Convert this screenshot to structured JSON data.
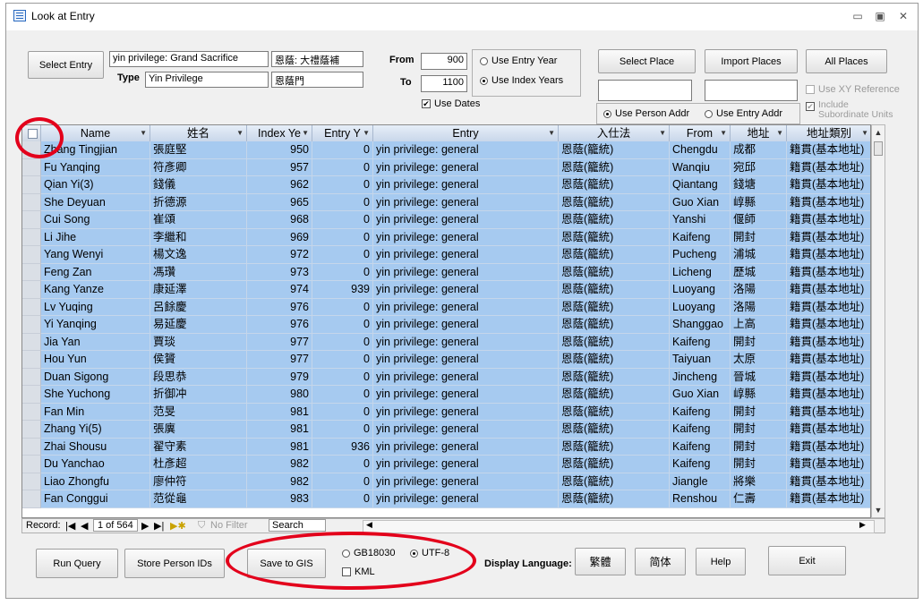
{
  "window": {
    "title": "Look at Entry",
    "controls": [
      "▭",
      "▣",
      "✕"
    ]
  },
  "top": {
    "select_entry_label": "Select Entry",
    "entry_value": "yin privilege: Grand Sacrifice",
    "entry_value_chn": "恩蔭: 大禮蔭補",
    "type_label": "Type",
    "type_value": "Yin Privilege",
    "type_value_chn": "恩蔭門",
    "from_label": "From",
    "from_value": "900",
    "to_label": "To",
    "to_value": "1100",
    "use_entry_year": "Use Entry Year",
    "use_index_years": "Use Index Years",
    "use_dates": "Use Dates",
    "select_place": "Select Place",
    "import_places": "Import Places",
    "all_places": "All Places",
    "use_xy_reference": "Use XY Reference",
    "include_subordinate": "Include Subordinate Units",
    "use_person_addr": "Use Person Addr",
    "use_entry_addr": "Use Entry Addr"
  },
  "grid": {
    "headers": [
      "Name",
      "姓名",
      "Index Ye",
      "Entry Y",
      "Entry",
      "入仕法",
      "From",
      "地址",
      "地址類別"
    ],
    "rows": [
      [
        "Zhang Tingjian",
        "張庭堅",
        "950",
        "0",
        "yin privilege: general",
        "恩蔭(籠統)",
        "Chengdu",
        "成都",
        "籍貫(基本地址)"
      ],
      [
        "Fu Yanqing",
        "符彥卿",
        "957",
        "0",
        "yin privilege: general",
        "恩蔭(籠統)",
        "Wanqiu",
        "宛邱",
        "籍貫(基本地址)"
      ],
      [
        "Qian Yi(3)",
        "錢儀",
        "962",
        "0",
        "yin privilege: general",
        "恩蔭(籠統)",
        "Qiantang",
        "錢塘",
        "籍貫(基本地址)"
      ],
      [
        "She Deyuan",
        "折德源",
        "965",
        "0",
        "yin privilege: general",
        "恩蔭(籠統)",
        "Guo Xian",
        "崞縣",
        "籍貫(基本地址)"
      ],
      [
        "Cui Song",
        "崔頌",
        "968",
        "0",
        "yin privilege: general",
        "恩蔭(籠統)",
        "Yanshi",
        "偃師",
        "籍貫(基本地址)"
      ],
      [
        "Li Jihe",
        "李繼和",
        "969",
        "0",
        "yin privilege: general",
        "恩蔭(籠統)",
        "Kaifeng",
        "開封",
        "籍貫(基本地址)"
      ],
      [
        "Yang Wenyi",
        "楊文逸",
        "972",
        "0",
        "yin privilege: general",
        "恩蔭(籠統)",
        "Pucheng",
        "浦城",
        "籍貫(基本地址)"
      ],
      [
        "Feng Zan",
        "馮瓚",
        "973",
        "0",
        "yin privilege: general",
        "恩蔭(籠統)",
        "Licheng",
        "歷城",
        "籍貫(基本地址)"
      ],
      [
        "Kang Yanze",
        "康延澤",
        "974",
        "939",
        "yin privilege: general",
        "恩蔭(籠統)",
        "Luoyang",
        "洛陽",
        "籍貫(基本地址)"
      ],
      [
        "Lv Yuqing",
        "呂餘慶",
        "976",
        "0",
        "yin privilege: general",
        "恩蔭(籠統)",
        "Luoyang",
        "洛陽",
        "籍貫(基本地址)"
      ],
      [
        "Yi Yanqing",
        "易延慶",
        "976",
        "0",
        "yin privilege: general",
        "恩蔭(籠統)",
        "Shanggao",
        "上高",
        "籍貫(基本地址)"
      ],
      [
        "Jia Yan",
        "賈琰",
        "977",
        "0",
        "yin privilege: general",
        "恩蔭(籠統)",
        "Kaifeng",
        "開封",
        "籍貫(基本地址)"
      ],
      [
        "Hou Yun",
        "侯贇",
        "977",
        "0",
        "yin privilege: general",
        "恩蔭(籠統)",
        "Taiyuan",
        "太原",
        "籍貫(基本地址)"
      ],
      [
        "Duan Sigong",
        "段思恭",
        "979",
        "0",
        "yin privilege: general",
        "恩蔭(籠統)",
        "Jincheng",
        "晉城",
        "籍貫(基本地址)"
      ],
      [
        "She Yuchong",
        "折御冲",
        "980",
        "0",
        "yin privilege: general",
        "恩蔭(籠統)",
        "Guo Xian",
        "崞縣",
        "籍貫(基本地址)"
      ],
      [
        "Fan Min",
        "范旻",
        "981",
        "0",
        "yin privilege: general",
        "恩蔭(籠統)",
        "Kaifeng",
        "開封",
        "籍貫(基本地址)"
      ],
      [
        "Zhang Yi(5)",
        "張廙",
        "981",
        "0",
        "yin privilege: general",
        "恩蔭(籠統)",
        "Kaifeng",
        "開封",
        "籍貫(基本地址)"
      ],
      [
        "Zhai Shousu",
        "翟守素",
        "981",
        "936",
        "yin privilege: general",
        "恩蔭(籠統)",
        "Kaifeng",
        "開封",
        "籍貫(基本地址)"
      ],
      [
        "Du Yanchao",
        "杜彥超",
        "982",
        "0",
        "yin privilege: general",
        "恩蔭(籠統)",
        "Kaifeng",
        "開封",
        "籍貫(基本地址)"
      ],
      [
        "Liao Zhongfu",
        "廖仲符",
        "982",
        "0",
        "yin privilege: general",
        "恩蔭(籠統)",
        "Jiangle",
        "將樂",
        "籍貫(基本地址)"
      ],
      [
        "Fan Conggui",
        "范從龜",
        "983",
        "0",
        "yin privilege: general",
        "恩蔭(籠統)",
        "Renshou",
        "仁壽",
        "籍貫(基本地址)"
      ]
    ]
  },
  "navbar": {
    "record_label": "Record:",
    "first": "|◀",
    "prev": "◀",
    "position": "1 of 564",
    "next": "▶",
    "last": "▶|",
    "new": "▶✱",
    "filter": "No Filter",
    "search": "Search"
  },
  "bottom": {
    "run_query": "Run Query",
    "store_person_ids": "Store Person IDs",
    "save_to_gis": "Save to GIS",
    "gb18030": "GB18030",
    "utf8": "UTF-8",
    "kml": "KML",
    "display_language": "Display Language:",
    "trad": "繁體",
    "simp": "简体",
    "help": "Help",
    "exit": "Exit"
  },
  "colors": {
    "selection": "#a6caf0",
    "annotation_ring": "#e3001b"
  }
}
